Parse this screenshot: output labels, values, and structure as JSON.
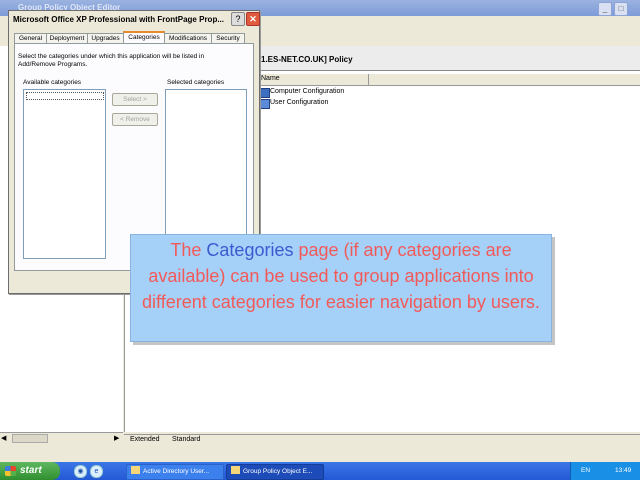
{
  "bg_window": {
    "title": "Group Policy Object Editor",
    "controls": [
      "_",
      "□"
    ]
  },
  "policy": {
    "title": "1.ES-NET.CO.UK] Policy",
    "column_name": "Name",
    "items": [
      "Computer Configuration",
      "User Configuration"
    ]
  },
  "bottom_tabs": [
    "Extended",
    "Standard"
  ],
  "dialog": {
    "title": "Microsoft Office XP Professional with FrontPage Prop...",
    "help_label": "?",
    "close_label": "✕",
    "tabs": [
      "General",
      "Deployment",
      "Upgrades",
      "Categories",
      "Modifications",
      "Security"
    ],
    "active_tab": "Categories",
    "instructions": "Select the categories under which this application will be listed in Add/Remove Programs.",
    "available_label": "Available categories",
    "selected_label": "Selected categories",
    "select_button": "Select >",
    "remove_button": "< Remove"
  },
  "callout": {
    "part1": "The ",
    "highlight": "Categories",
    "part2": " page (if any categories are available) can be used to group applications into different categories for easier navigation by users."
  },
  "taskbar": {
    "start_label": "start",
    "buttons": [
      "Active Directory User...",
      "Group Policy Object E..."
    ],
    "tray_language": "EN",
    "clock": "13:49"
  },
  "colors": {
    "callout_bg": "#a5d0f7",
    "callout_text": "#f25a5a",
    "callout_highlight": "#3a5bd1",
    "taskbar": "#2458d6",
    "active_tab_accent": "#e68b2c"
  }
}
